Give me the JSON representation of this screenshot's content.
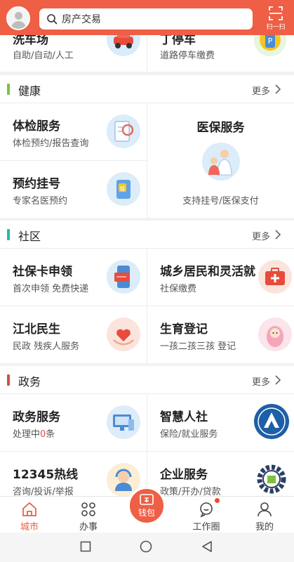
{
  "header": {
    "search_placeholder": "房产交易",
    "scan_label": "扫一扫"
  },
  "top_row": {
    "left_title": "洗车场",
    "left_sub": "自助/自动/人工",
    "right_title": "丁停车",
    "right_sub": "道路停车缴费"
  },
  "health": {
    "title": "健康",
    "more": "更多",
    "accent": "#7cc23f",
    "items": [
      {
        "title": "体检服务",
        "sub": "体检预约/报告查询"
      },
      {
        "title": "预约挂号",
        "sub": "专家名医预约"
      },
      {
        "title": "医保服务",
        "sub": "支持挂号/医保支付"
      }
    ]
  },
  "community": {
    "title": "社区",
    "more": "更多",
    "accent": "#2ab7b0",
    "items": [
      {
        "title": "社保卡申领",
        "sub": "首次申领 免费快递"
      },
      {
        "title": "城乡居民和灵活就",
        "sub": "社保缴费"
      },
      {
        "title": "江北民生",
        "sub": "民政  残疾人服务"
      },
      {
        "title": "生育登记",
        "sub": "一孩二孩三孩 登记"
      }
    ]
  },
  "gov": {
    "title": "政务",
    "more": "更多",
    "accent": "#c8553d",
    "items": [
      {
        "title": "政务服务",
        "sub_prefix": "处理中",
        "sub_count": "0",
        "sub_suffix": "条"
      },
      {
        "title": "智慧人社",
        "sub": "保险/就业服务"
      },
      {
        "title": "12345热线",
        "sub": "咨询/投诉/举报"
      },
      {
        "title": "企业服务",
        "sub": "政策/开办/贷款"
      }
    ]
  },
  "tabbar": {
    "tabs": [
      {
        "label": "城市"
      },
      {
        "label": "办事"
      },
      {
        "label": "钱包"
      },
      {
        "label": "工作圈"
      },
      {
        "label": "我的"
      }
    ],
    "active_color": "#ee5f45"
  }
}
